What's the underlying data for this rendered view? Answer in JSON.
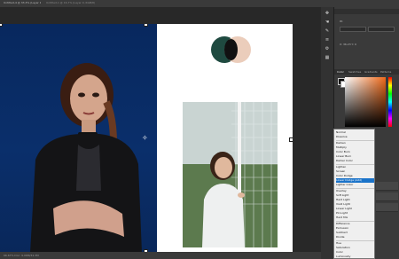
{
  "window": {
    "doc_tab": "Untitled-4 @ 33.3% (Layer 1, RGB/8#)",
    "doc_tab_2": "Untitled-1 @ 16.7% (Layer 0, RGB/8)"
  },
  "status_bar": {
    "text": "66.67%  Doc: 9.06M/34.3M"
  },
  "properties": {
    "label": "W:",
    "coord": "X: 36.23 Y: 0"
  },
  "panel_tabs": [
    "Color",
    "Swatches",
    "Gradients",
    "Patterns"
  ],
  "blend_modes": {
    "items": [
      "Normal",
      "Dissolve",
      "Darken",
      "Multiply",
      "Color Burn",
      "Linear Burn",
      "Darker Color",
      "Lighten",
      "Screen",
      "Color Dodge",
      "Linear Dodge (Add)",
      "Lighter Color",
      "Overlay",
      "Soft Light",
      "Hard Light",
      "Vivid Light",
      "Linear Light",
      "Pin Light",
      "Hard Mix",
      "Difference",
      "Exclusion",
      "Subtract",
      "Divide",
      "Hue",
      "Saturation",
      "Color",
      "Luminosity"
    ],
    "selected": "Linear Dodge (Add)"
  },
  "colors": {
    "blue_bg": "#0a2f6b",
    "circle_green": "#1f4a40",
    "circle_peach": "#e9c8b4",
    "accent_selection": "#1a73c9"
  }
}
